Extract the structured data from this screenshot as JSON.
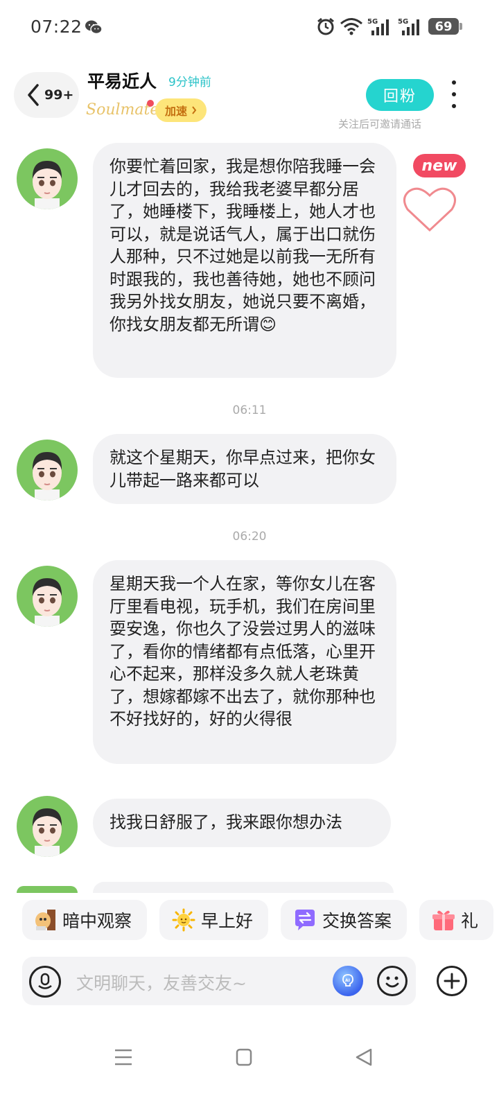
{
  "status_bar": {
    "time": "07:22",
    "battery": "69",
    "icons": [
      "wechat-icon",
      "alarm-icon",
      "wifi-icon",
      "signal-5g-icon",
      "signal-5g-icon-2",
      "battery-icon"
    ]
  },
  "header": {
    "unread_count": "99+",
    "contact_name": "平易近人",
    "last_seen": "9分钟前",
    "badge_brand": "Soulmate",
    "speed_label": "加速",
    "follow_label": "回粉",
    "follow_hint": "关注后可邀请通话"
  },
  "colors": {
    "accent": "#25d4cf",
    "bubble": "#f2f2f4",
    "new_badge": "#f14a62",
    "speed_bg": "#fde57a",
    "avatar_bg": "#7cc660"
  },
  "new_badge": "new",
  "messages": [
    {
      "text": "你要忙着回家，我是想你陪我睡一会儿才回去的，我给我老婆早都分居了，她睡楼下，我睡楼上，她人才也可以，就是说话气人，属于出口就伤人那种，只不过她是以前我一无所有时跟我的，我也善待她，她也不顾问我另外找女朋友，她说只要不离婚，你找女朋友都无所谓😊"
    },
    {
      "time": "06:11",
      "text": "就这个星期天，你早点过来，把你女儿带起一路来都可以"
    },
    {
      "time": "06:20",
      "text": "星期天我一个人在家，等你女儿在客厅里看电视，玩手机，我们在房间里耍安逸，你也久了没尝过男人的滋味了，看你的情绪都有点低落，心里开心不起来，那样没多久就人老珠黄了，想嫁都嫁不出去了，就你那种也不好找好的，好的火得很"
    },
    {
      "text": "找我日舒服了，我来跟你想办法"
    }
  ],
  "quick_chips": [
    {
      "label": "暗中观察",
      "icon": "peek-icon"
    },
    {
      "label": "早上好",
      "icon": "sun-icon"
    },
    {
      "label": "交换答案",
      "icon": "exchange-icon"
    },
    {
      "label": "礼",
      "icon": "gift-icon"
    }
  ],
  "input": {
    "placeholder": "文明聊天，友善交友~"
  }
}
